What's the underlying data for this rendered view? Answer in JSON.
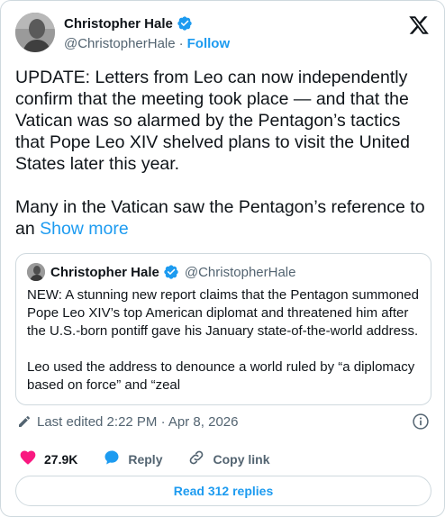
{
  "author": {
    "name": "Christopher Hale",
    "handle": "@ChristopherHale",
    "separator": "·",
    "follow_label": "Follow"
  },
  "tweet": {
    "text": "UPDATE: Letters from Leo can now independently confirm that the meeting took place — and that the Vatican was so alarmed by the Pentagon’s tactics that Pope Leo XIV shelved plans to visit the United States later this year.\n\nMany in the Vatican saw the Pentagon’s reference to an ",
    "show_more": "Show more"
  },
  "quote": {
    "name": "Christopher Hale",
    "handle": "@ChristopherHale",
    "text": "NEW: A stunning new report claims that the Pentagon summoned Pope Leo XIV’s top American diplomat and threatened him after the U.S.-born pontiff gave his January state-of-the-world address.\n\nLeo used the address to denounce a world ruled by “a diplomacy based on force” and “zeal"
  },
  "meta": {
    "edited": "Last edited 2:22 PM · Apr 8, 2026"
  },
  "actions": {
    "likes": "27.9K",
    "reply_label": "Reply",
    "copy_label": "Copy link"
  },
  "replies_button": "Read 312 replies",
  "colors": {
    "accent": "#1d9bf0",
    "like": "#f91880",
    "secondary_text": "#536471",
    "border": "#cfd9de"
  },
  "icons": [
    "verified-badge-icon",
    "x-logo-icon",
    "pencil-icon",
    "info-icon",
    "heart-icon",
    "reply-bubble-icon",
    "link-icon"
  ]
}
